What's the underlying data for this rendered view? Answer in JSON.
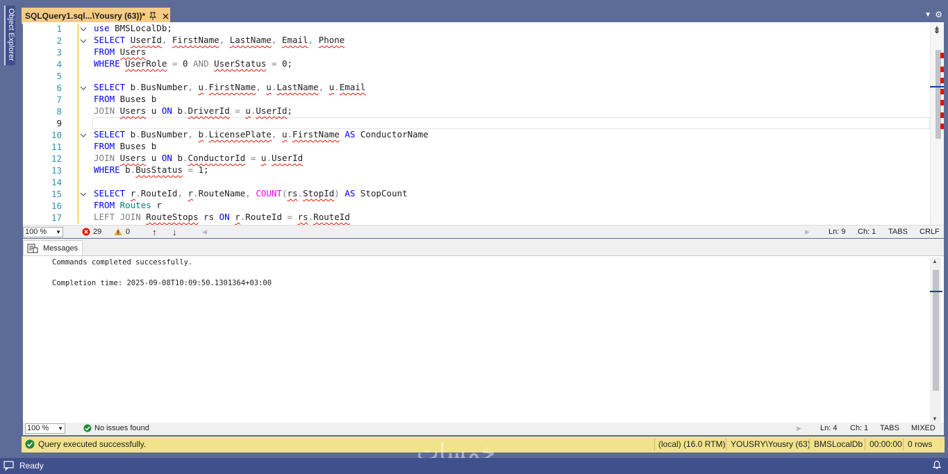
{
  "left_rail": {
    "object_explorer_label": "Object Explorer"
  },
  "tab": {
    "title": "SQLQuery1.sql...\\Yousry (63))*",
    "pin_glyph": "🖈",
    "close_glyph": "✕"
  },
  "editor": {
    "line_numbers": [
      "1",
      "2",
      "3",
      "4",
      "5",
      "6",
      "7",
      "8",
      "9",
      "10",
      "11",
      "12",
      "13",
      "14",
      "15",
      "16",
      "17"
    ]
  },
  "editor_status": {
    "zoom": "100 %",
    "errors": "29",
    "warnings": "0",
    "line": "Ln: 9",
    "col": "Ch: 1",
    "tabs": "TABS",
    "eol": "CRLF"
  },
  "messages": {
    "tab_label": "Messages",
    "line1": "Commands completed successfully.",
    "line2": "Completion time: 2025-09-08T10:09:50.1301364+03:00"
  },
  "messages_status": {
    "zoom": "100 %",
    "issues": "No issues found",
    "line": "Ln: 4",
    "col": "Ch: 1",
    "tabs": "TABS",
    "eol": "MIXED"
  },
  "query_bar": {
    "message": "Query executed successfully.",
    "server": "(local) (16.0 RTM)",
    "user": "YOUSRY\\Yousry (63)",
    "database": "BMSLocalDb",
    "elapsed": "00:00:00",
    "rows": "0 rows"
  },
  "app_status": {
    "state": "Ready"
  },
  "watermark": {
    "text": "خمسات"
  },
  "colors": {
    "keyword": "#0000ff",
    "gray_keyword": "#808080",
    "function": "#ff00ff",
    "table": "#008080",
    "line_number": "#2b91af",
    "tab_active": "#f5cc84",
    "query_bar": "#f1e38c",
    "app_status": "#40508d"
  }
}
